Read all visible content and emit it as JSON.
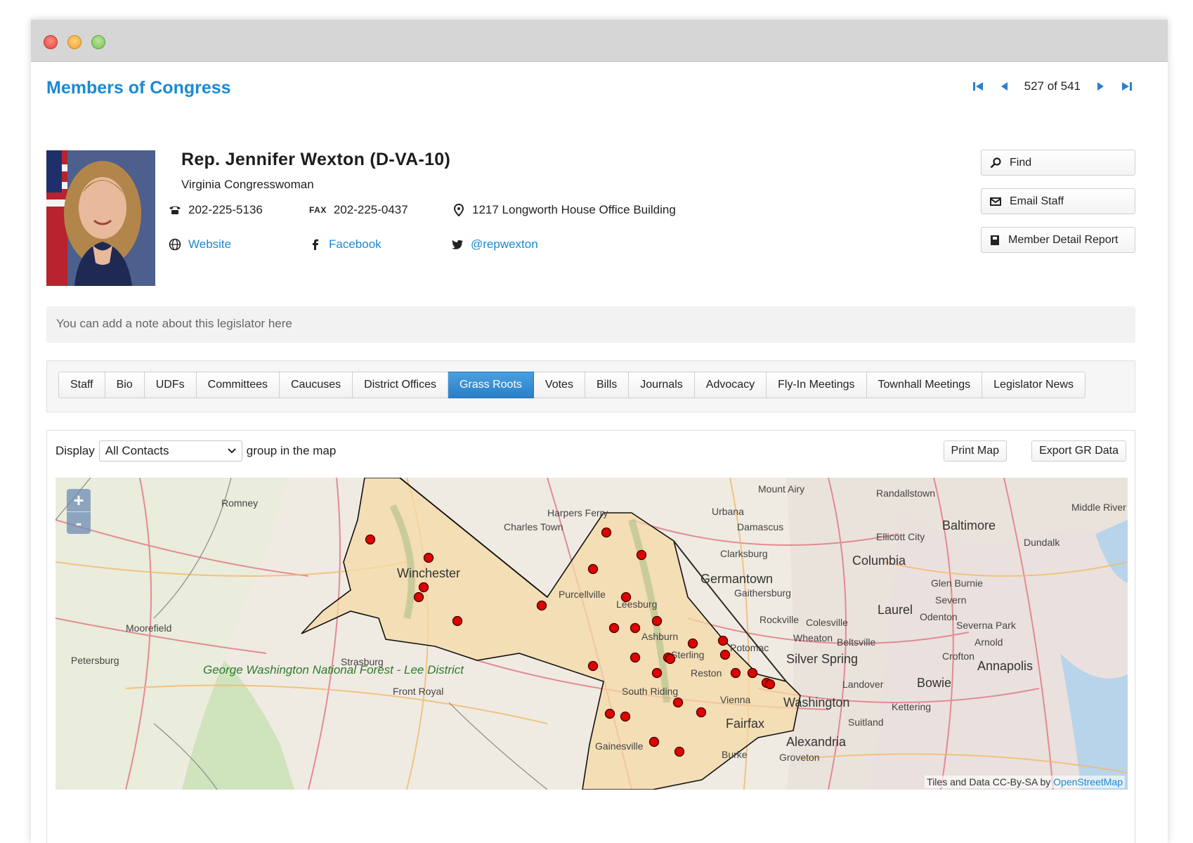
{
  "page": {
    "title": "Members of Congress"
  },
  "pager": {
    "position": "527 of 541"
  },
  "member": {
    "name": "Rep. Jennifer Wexton (D-VA-10)",
    "subtitle": "Virginia Congresswoman",
    "phone": "202-225-5136",
    "fax_label": "FAX",
    "fax": "202-225-0437",
    "address": "1217 Longworth House Office Building",
    "website_label": "Website",
    "facebook_label": "Facebook",
    "twitter_label": "@repwexton"
  },
  "actions": {
    "find": "Find",
    "email_staff": "Email Staff",
    "member_detail_report": "Member Detail Report"
  },
  "note": {
    "placeholder": "You can add a note about this legislator here"
  },
  "tabs": [
    {
      "label": "Staff"
    },
    {
      "label": "Bio"
    },
    {
      "label": "UDFs"
    },
    {
      "label": "Committees"
    },
    {
      "label": "Caucuses"
    },
    {
      "label": "District Offices"
    },
    {
      "label": "Grass Roots",
      "active": true
    },
    {
      "label": "Votes"
    },
    {
      "label": "Bills"
    },
    {
      "label": "Journals"
    },
    {
      "label": "Advocacy"
    },
    {
      "label": "Fly-In Meetings"
    },
    {
      "label": "Townhall Meetings"
    },
    {
      "label": "Legislator News"
    }
  ],
  "grassroots": {
    "display_label": "Display",
    "selected_group": "All Contacts",
    "suffix_label": "group in the map",
    "print_map": "Print Map",
    "export_data": "Export GR Data"
  },
  "map": {
    "zoom_in": "+",
    "zoom_out": "-",
    "attribution_prefix": "Tiles and Data CC-By-SA by",
    "attribution_link": "OpenStreetMap",
    "places": [
      "Romney",
      "Mount Airy",
      "Randallstown",
      "Middle River",
      "Harpers Ferry",
      "Charles Town",
      "Urbana",
      "Damascus",
      "Baltimore",
      "Ellicott City",
      "Dundalk",
      "Clarksburg",
      "Columbia",
      "Winchester",
      "Germantown",
      "Gaithersburg",
      "Glen Burnie",
      "Purcellville",
      "Leesburg",
      "Severn",
      "Laurel",
      "Moorefield",
      "Rockville",
      "Colesville",
      "Odenton",
      "Severna Park",
      "Ashburn",
      "Wheaton",
      "Beltsville",
      "Arnold",
      "Potomac",
      "Petersburg",
      "Sterling",
      "Silver Spring",
      "Crofton",
      "Strasburg",
      "Reston",
      "Annapolis",
      "Bowie",
      "Landover",
      "South Riding",
      "Front Royal",
      "Vienna",
      "Washington",
      "Kettering",
      "Fairfax",
      "Suitland",
      "Alexandria",
      "Gainesville",
      "Burke",
      "Groveton"
    ],
    "forest_label": "George Washington National Forest - Lee District",
    "colors": {
      "district_fill": "#f6d9a6",
      "marker": "#e00000",
      "road": "#e07a86"
    }
  }
}
